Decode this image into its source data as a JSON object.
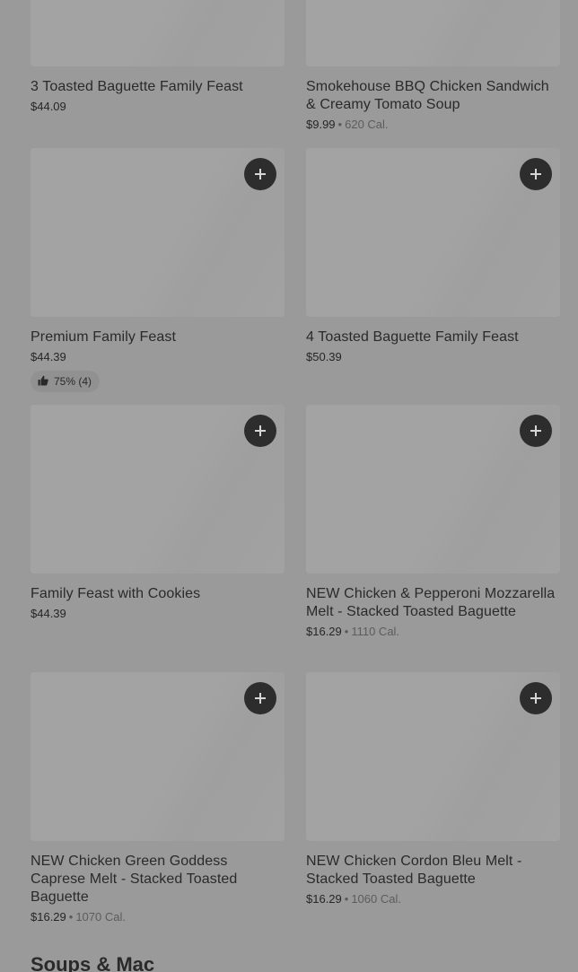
{
  "items": [
    {
      "name": "3 Toasted Baguette Family Feast",
      "price": "$44.09"
    },
    {
      "name": "Smokehouse BBQ Chicken Sandwich & Creamy Tomato Soup",
      "price": "$9.99",
      "sep": "•",
      "calories": "620 Cal."
    },
    {
      "name": "Premium Family Feast",
      "price": "$44.39",
      "rating": "75% (4)"
    },
    {
      "name": "4 Toasted Baguette Family Feast",
      "price": "$50.39"
    },
    {
      "name": "Family Feast with Cookies",
      "price": "$44.39"
    },
    {
      "name": "NEW Chicken & Pepperoni Mozzarella Melt - Stacked Toasted Baguette",
      "price": "$16.29",
      "sep": "•",
      "calories": "1110 Cal."
    },
    {
      "name": "NEW Chicken Green Goddess Caprese Melt - Stacked Toasted Baguette",
      "price": "$16.29",
      "sep": "•",
      "calories": "1070 Cal."
    },
    {
      "name": "NEW Chicken Cordon Bleu Melt - Stacked Toasted Baguette",
      "price": "$16.29",
      "sep": "•",
      "calories": "1060 Cal."
    }
  ],
  "next_section": {
    "title": "Soups & Mac"
  },
  "icons": {
    "add": "plus-icon",
    "rating": "thumbs-up-icon"
  },
  "colors": {
    "button": "#2d2d2d",
    "overlay": "#9a9a9a"
  }
}
